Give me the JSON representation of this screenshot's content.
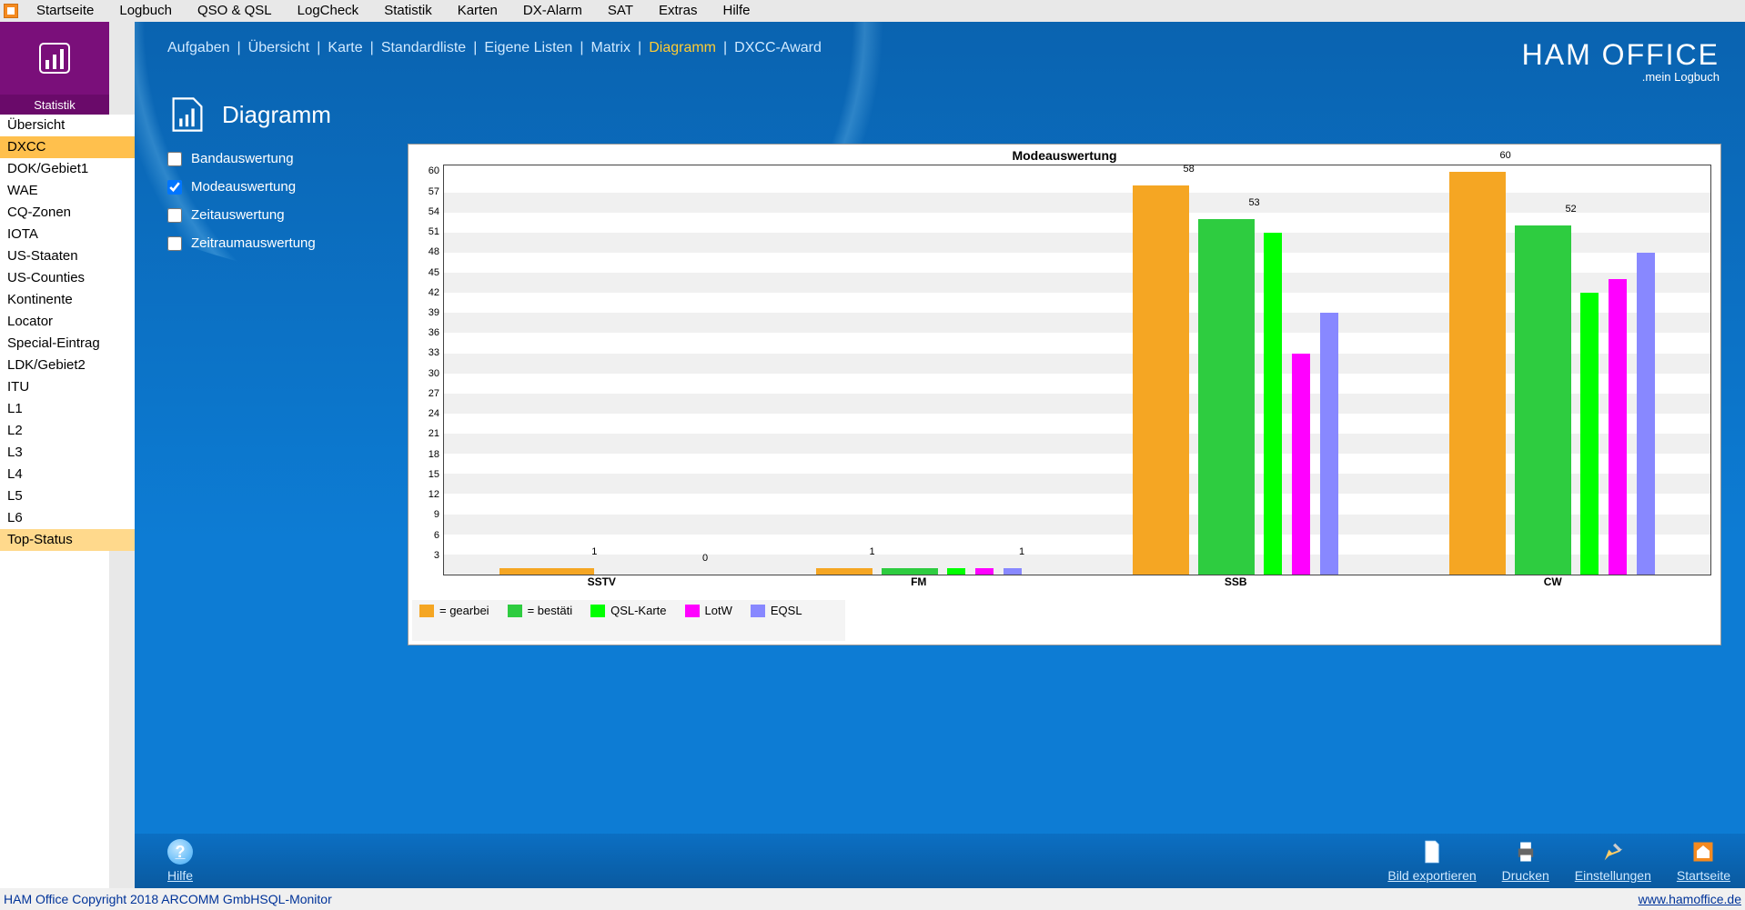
{
  "menu": [
    "Startseite",
    "Logbuch",
    "QSO & QSL",
    "LogCheck",
    "Statistik",
    "Karten",
    "DX-Alarm",
    "SAT",
    "Extras",
    "Hilfe"
  ],
  "purple": {
    "label": "Statistik"
  },
  "sidebar": {
    "items": [
      {
        "label": "Übersicht",
        "sel": false
      },
      {
        "label": "DXCC",
        "sel": true
      },
      {
        "label": "DOK/Gebiet1",
        "sel": false
      },
      {
        "label": "WAE",
        "sel": false
      },
      {
        "label": "CQ-Zonen",
        "sel": false
      },
      {
        "label": "IOTA",
        "sel": false
      },
      {
        "label": "US-Staaten",
        "sel": false
      },
      {
        "label": "US-Counties",
        "sel": false
      },
      {
        "label": "Kontinente",
        "sel": false
      },
      {
        "label": "Locator",
        "sel": false
      },
      {
        "label": "Special-Eintrag",
        "sel": false
      },
      {
        "label": "LDK/Gebiet2",
        "sel": false
      },
      {
        "label": "ITU",
        "sel": false
      },
      {
        "label": "L1",
        "sel": false
      },
      {
        "label": "L2",
        "sel": false
      },
      {
        "label": "L3",
        "sel": false
      },
      {
        "label": "L4",
        "sel": false
      },
      {
        "label": "L5",
        "sel": false
      },
      {
        "label": "L6",
        "sel": false
      },
      {
        "label": "Top-Status",
        "sel2": true
      }
    ]
  },
  "crumbs": {
    "items": [
      "Aufgaben",
      "Übersicht",
      "Karte",
      "Standardliste",
      "Eigene Listen",
      "Matrix",
      "Diagramm",
      "DXCC-Award"
    ],
    "active": "Diagramm"
  },
  "brand": {
    "line1": "HAM OFFICE",
    "line2": ".mein Logbuch"
  },
  "page_title": "Diagramm",
  "options": [
    {
      "label": "Bandauswertung",
      "checked": false
    },
    {
      "label": "Modeauswertung",
      "checked": true
    },
    {
      "label": "Zeitauswertung",
      "checked": false
    },
    {
      "label": "Zeitraumauswertung",
      "checked": false
    }
  ],
  "chart_data": {
    "type": "bar",
    "title": "Modeauswertung",
    "ylim": [
      0,
      61
    ],
    "yticks": [
      3,
      6,
      9,
      12,
      15,
      18,
      21,
      24,
      27,
      30,
      33,
      36,
      39,
      42,
      45,
      48,
      51,
      54,
      57,
      60
    ],
    "categories": [
      "SSTV",
      "FM",
      "SSB",
      "CW"
    ],
    "series": [
      {
        "name": "= gearbei",
        "color": "#f5a623",
        "values": [
          1,
          1,
          58,
          60
        ]
      },
      {
        "name": "= bestäti",
        "color": "#2ecc40",
        "values": [
          0,
          1,
          53,
          52
        ]
      },
      {
        "name": "QSL-Karte",
        "color": "#00ff00",
        "values": [
          null,
          1,
          51,
          42
        ]
      },
      {
        "name": "LotW",
        "color": "#ff00ff",
        "values": [
          null,
          1,
          33,
          44
        ]
      },
      {
        "name": "EQSL",
        "color": "#8888ff",
        "values": [
          null,
          1,
          39,
          48
        ]
      }
    ],
    "value_labels": [
      {
        "cat": "SSTV",
        "value": 1,
        "series": 0
      },
      {
        "cat": "SSTV",
        "value": 0,
        "series": 1
      },
      {
        "cat": "FM",
        "value": 1,
        "series": 0
      },
      {
        "cat": "FM",
        "value": 1,
        "series": 4
      },
      {
        "cat": "SSB",
        "value": 58,
        "series": 0
      },
      {
        "cat": "SSB",
        "value": 53,
        "series": 1
      },
      {
        "cat": "CW",
        "value": 60,
        "series": 0
      },
      {
        "cat": "CW",
        "value": 52,
        "series": 1
      }
    ]
  },
  "bottom": {
    "hilfe": "Hilfe",
    "actions": [
      {
        "label": "Bild exportieren",
        "icon": "export"
      },
      {
        "label": "Drucken",
        "icon": "print"
      },
      {
        "label": "Einstellungen",
        "icon": "settings"
      },
      {
        "label": "Startseite",
        "icon": "home"
      }
    ]
  },
  "status": {
    "left": "HAM Office Copyright 2018 ARCOMM GmbH",
    "sql": "SQL-Monitor",
    "right": "www.hamoffice.de"
  }
}
